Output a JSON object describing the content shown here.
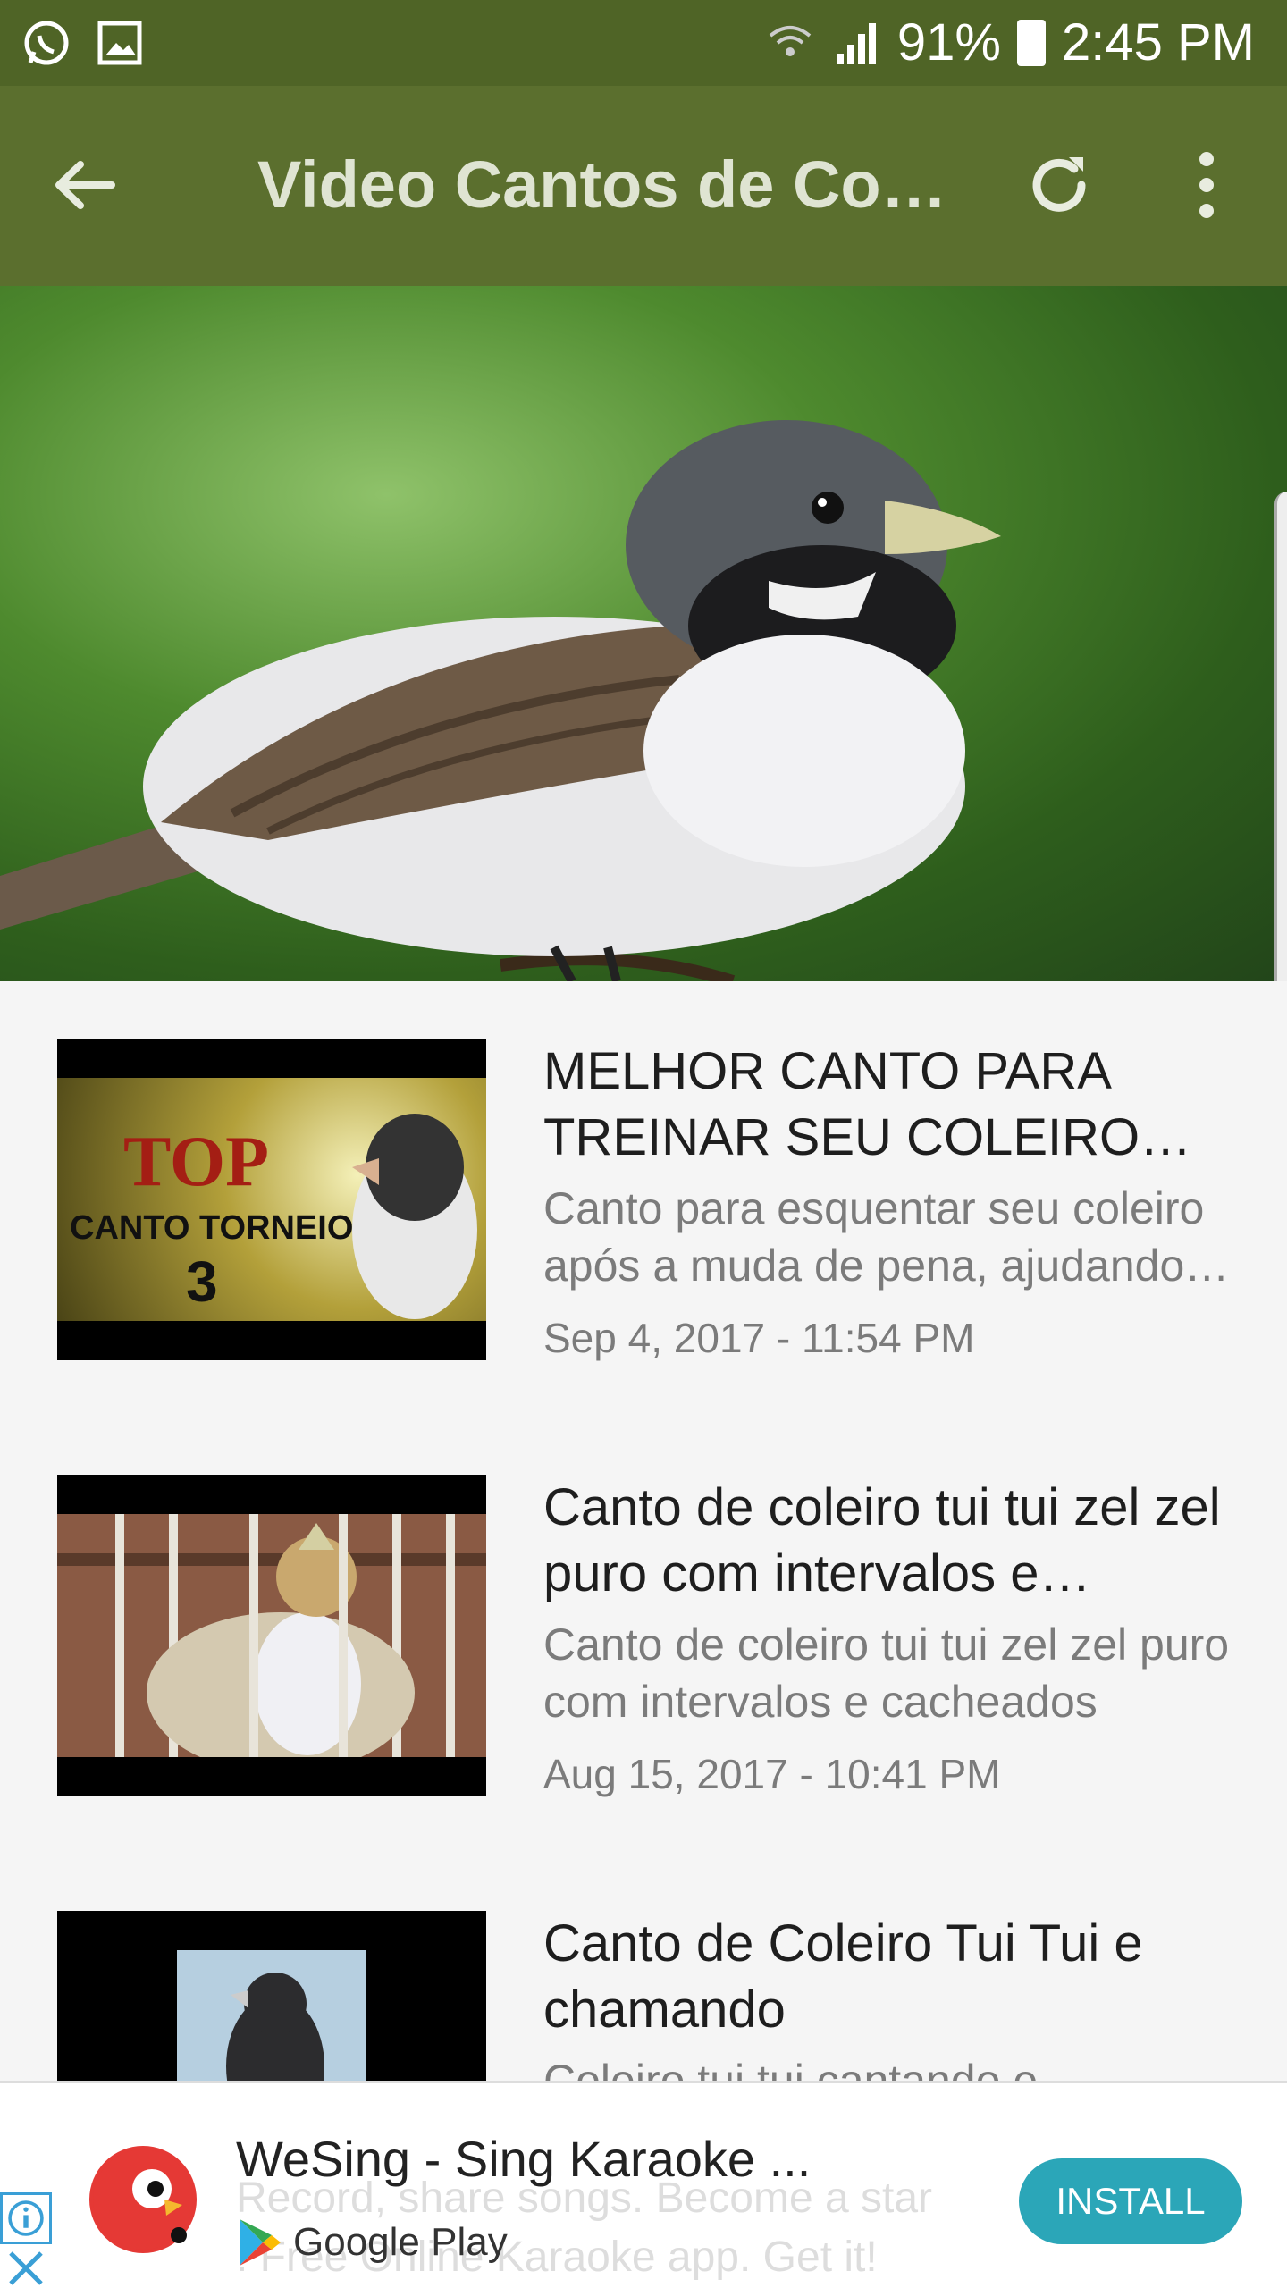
{
  "status_bar": {
    "battery": "91%",
    "time": "2:45 PM",
    "icons": [
      "whatsapp-icon",
      "gallery-icon",
      "wifi-icon",
      "signal-icon",
      "battery-icon"
    ]
  },
  "app_bar": {
    "title": "Video Cantos de Coleiro",
    "icons": [
      "back-arrow-icon",
      "refresh-icon",
      "more-vert-icon"
    ]
  },
  "hero": {
    "subject": "bird-photo"
  },
  "videos": [
    {
      "title": "MELHOR CANTO PARA TREINAR SEU COLEIRO TOP",
      "description": "Canto para esquentar seu coleiro após a muda de pena, ajudando no treino",
      "date": "Sep 4, 2017 - 11:54 PM",
      "thumb_text_top": "TOP",
      "thumb_text_mid": "CANTO TORNEIO",
      "thumb_text_num": "3"
    },
    {
      "title": "Canto de coleiro tui tui zel zel puro com intervalos e cacheados",
      "description": "Canto de coleiro tui tui zel zel puro com intervalos e cacheados",
      "date": "Aug 15, 2017 - 10:41 PM"
    },
    {
      "title": "Canto de Coleiro Tui Tui e chamando",
      "description": "Coleiro tui tui cantando e chamando",
      "date": ""
    }
  ],
  "ad": {
    "title": "WeSing - Sing Karaoke ...",
    "subtitle": "Record, share songs. Become a star ! Free Online Karaoke app. Get it!",
    "store": "Google Play",
    "install_label": "INSTALL",
    "accent": "#2ba6b8"
  },
  "colors": {
    "status_bar": "#4f6426",
    "app_bar": "#5b6f2e"
  }
}
